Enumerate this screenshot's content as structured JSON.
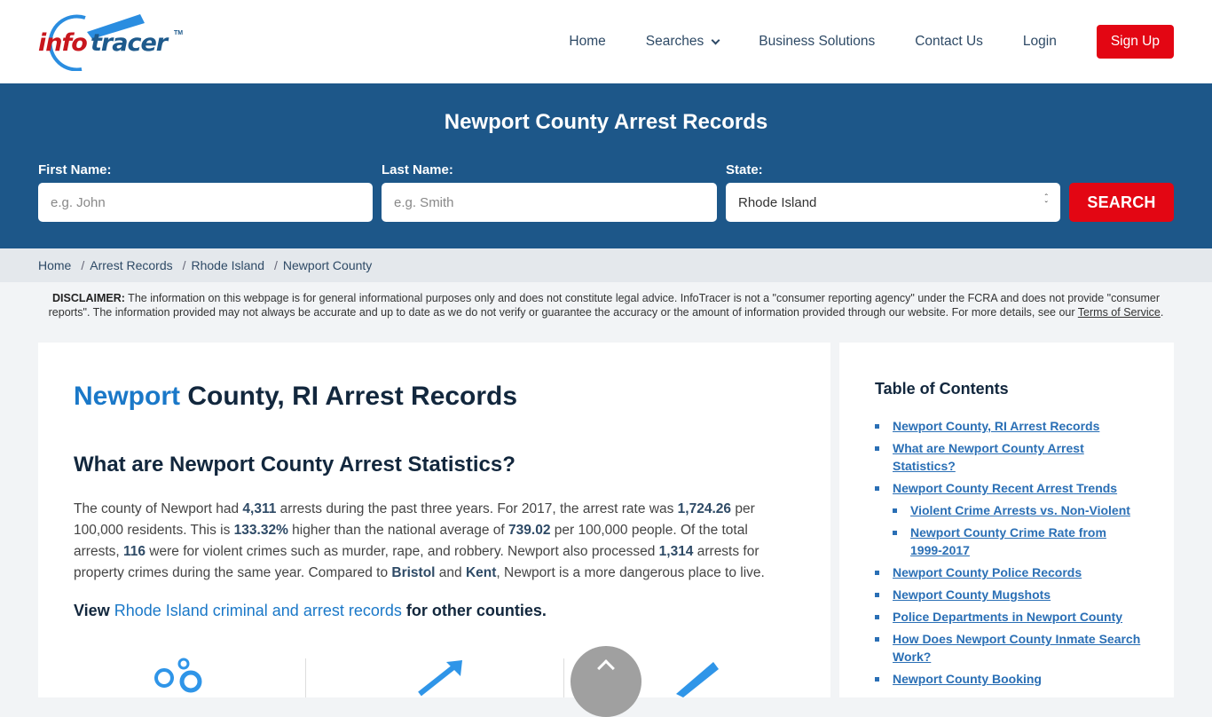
{
  "logo": {
    "part1": "info",
    "part2": "tracer",
    "tm": "TM"
  },
  "nav": {
    "home": "Home",
    "searches": "Searches",
    "business": "Business Solutions",
    "contact": "Contact Us",
    "login": "Login",
    "signup": "Sign Up"
  },
  "hero": {
    "title": "Newport County Arrest Records",
    "first_name_label": "First Name:",
    "first_name_placeholder": "e.g. John",
    "last_name_label": "Last Name:",
    "last_name_placeholder": "e.g. Smith",
    "state_label": "State:",
    "state_value": "Rhode Island",
    "search_button": "SEARCH"
  },
  "breadcrumb": [
    "Home",
    "Arrest Records",
    "Rhode Island",
    "Newport County"
  ],
  "disclaimer": {
    "label": "DISCLAIMER:",
    "text": " The information on this webpage is for general informational purposes only and does not constitute legal advice. InfoTracer is not a \"consumer reporting agency\" under the FCRA and does not provide \"consumer reports\". The information provided may not always be accurate and up to date as we do not verify or guarantee the accuracy or the amount of information provided through our website. For more details, see our ",
    "link": "Terms of Service",
    "end": "."
  },
  "main": {
    "title_highlight": "Newport",
    "title_rest": " County, RI Arrest Records",
    "stats_heading": "What are Newport County Arrest Statistics?",
    "stats": {
      "t1": "The county of Newport had ",
      "total_arrests": "4,311",
      "t2": " arrests during the past three years. For 2017, the arrest rate was ",
      "arrest_rate": "1,724.26",
      "t3": " per 100,000 residents. This is ",
      "pct_higher": "133.32%",
      "t4": " higher than the national average of ",
      "national_avg": "739.02",
      "t5": " per 100,000 people. Of the total arrests, ",
      "violent": "116",
      "t6": " were for violent crimes such as murder, rape, and robbery. Newport also processed ",
      "property": "1,314",
      "t7": " arrests for property crimes during the same year. Compared to ",
      "county1": "Bristol",
      "t8": " and ",
      "county2": "Kent",
      "t9": ", Newport is a more dangerous place to live."
    },
    "view": {
      "prefix": "View ",
      "link": "Rhode Island criminal and arrest records",
      "suffix": " for other counties."
    }
  },
  "toc": {
    "title": "Table of Contents",
    "items": [
      {
        "label": "Newport County, RI Arrest Records",
        "sub": false
      },
      {
        "label": "What are Newport County Arrest Statistics?",
        "sub": false
      },
      {
        "label": "Newport County Recent Arrest Trends",
        "sub": false
      },
      {
        "label": "Violent Crime Arrests vs. Non-Violent",
        "sub": true
      },
      {
        "label": "Newport County Crime Rate from 1999-2017",
        "sub": true
      },
      {
        "label": "Newport County Police Records",
        "sub": false
      },
      {
        "label": "Newport County Mugshots",
        "sub": false
      },
      {
        "label": "Police Departments in Newport County",
        "sub": false
      },
      {
        "label": "How Does Newport County Inmate Search Work?",
        "sub": false
      },
      {
        "label": "Newport County Booking",
        "sub": false
      }
    ]
  },
  "colors": {
    "primary": "#1d5789",
    "accent_red": "#e30613",
    "link_blue": "#1a78c8"
  }
}
